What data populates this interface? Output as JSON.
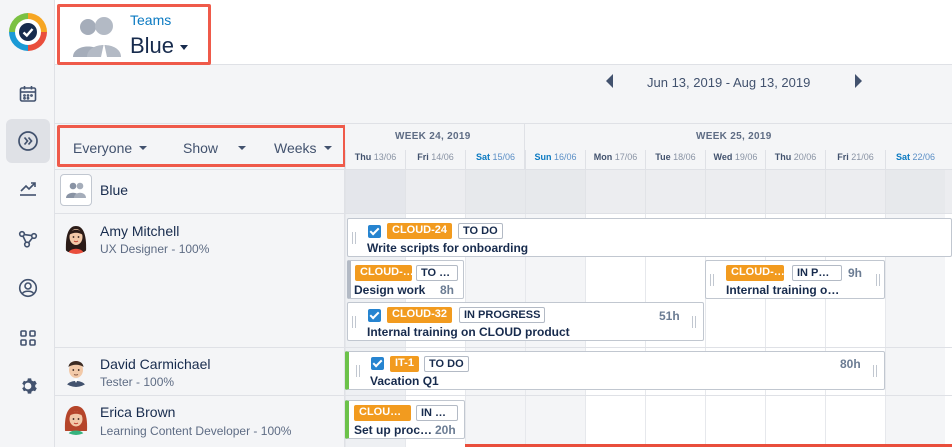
{
  "header": {
    "team_link": "Teams",
    "team_name": "Blue"
  },
  "rail": {
    "items": [
      {
        "icon": "calendar-icon"
      },
      {
        "icon": "forward-circle-icon",
        "active": true
      },
      {
        "icon": "trend-chart-icon"
      },
      {
        "icon": "share-nodes-icon"
      },
      {
        "icon": "user-circle-icon"
      },
      {
        "icon": "grid-apps-icon"
      },
      {
        "icon": "gear-icon"
      }
    ]
  },
  "datenav": {
    "range": "Jun 13, 2019 - Aug 13, 2019"
  },
  "toolbar": {
    "everyone": "Everyone",
    "show": "Show",
    "weeks": "Weeks"
  },
  "weeks": [
    "WEEK 24, 2019",
    "WEEK 25, 2019"
  ],
  "days": [
    {
      "dow": "Thu",
      "date": "13/06",
      "weekend": false
    },
    {
      "dow": "Fri",
      "date": "14/06",
      "weekend": false
    },
    {
      "dow": "Sat",
      "date": "15/06",
      "weekend": true
    },
    {
      "dow": "Sun",
      "date": "16/06",
      "weekend": true
    },
    {
      "dow": "Mon",
      "date": "17/06",
      "weekend": false
    },
    {
      "dow": "Tue",
      "date": "18/06",
      "weekend": false
    },
    {
      "dow": "Wed",
      "date": "19/06",
      "weekend": false
    },
    {
      "dow": "Thu",
      "date": "20/06",
      "weekend": false
    },
    {
      "dow": "Fri",
      "date": "21/06",
      "weekend": false
    },
    {
      "dow": "Sat",
      "date": "22/06",
      "weekend": true
    }
  ],
  "people": [
    {
      "name": "Blue",
      "role": ""
    },
    {
      "name": "Amy Mitchell",
      "role": "UX Designer - 100%"
    },
    {
      "name": "David Carmichael",
      "role": "Tester - 100%"
    },
    {
      "name": "Erica Brown",
      "role": "Learning Content Developer - 100%"
    }
  ],
  "cards": {
    "c1": {
      "key": "CLOUD-24",
      "status": "TO DO",
      "title": "Write scripts for onboarding"
    },
    "c2": {
      "key": "CLOUD-…",
      "status": "TO …",
      "title": "Design work",
      "hours": "8h"
    },
    "c3": {
      "key": "CLOUD-…",
      "status": "IN P…",
      "title": "Internal training o…",
      "hours": "9h"
    },
    "c4": {
      "key": "CLOUD-32",
      "status": "IN PROGRESS",
      "title": "Internal training on CLOUD product",
      "hours": "51h"
    },
    "c5": {
      "key": "IT-1",
      "status": "TO DO",
      "title": "Vacation Q1",
      "hours": "80h"
    },
    "c6": {
      "key": "CLOU…",
      "status": "IN …",
      "title": "Set up proc…",
      "hours": "20h"
    }
  },
  "colors": {
    "accent_blue": "#0b7ac2",
    "key_orange": "#f29b1f",
    "highlight_red": "#ef5a4a",
    "bar_green": "#6cc24a"
  }
}
